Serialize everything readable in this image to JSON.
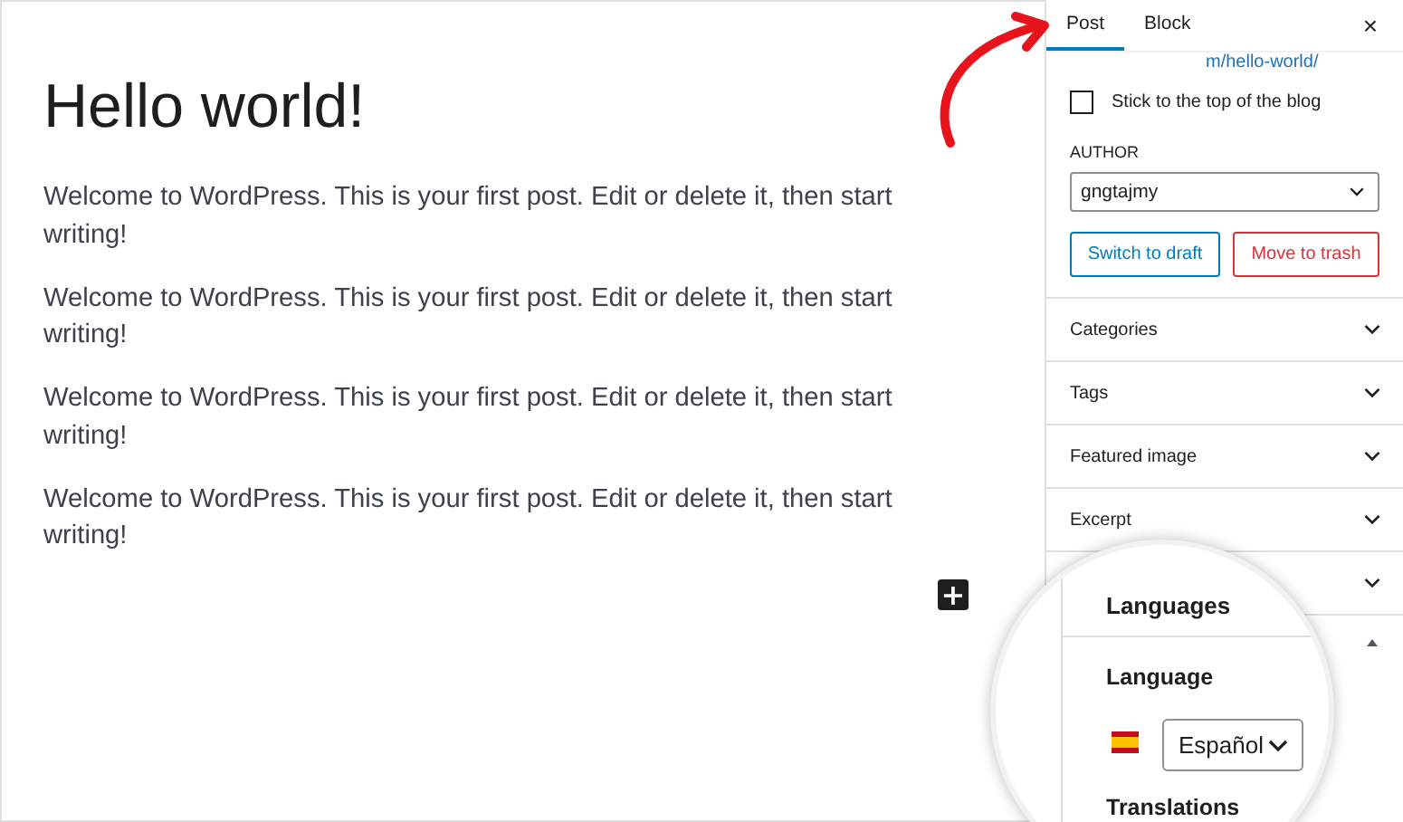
{
  "editor": {
    "title": "Hello world!",
    "paragraphs": [
      "Welcome to WordPress. This is your first post. Edit or delete it, then start writing!",
      "Welcome to WordPress. This is your first post. Edit or delete it, then start writing!",
      "Welcome to WordPress. This is your first post. Edit or delete it, then start writing!",
      "Welcome to WordPress. This is your first post. Edit or delete it, then start writing!"
    ],
    "inserter": "+"
  },
  "sidebar": {
    "tabs": [
      {
        "label": "Post",
        "selected": true
      },
      {
        "label": "Block",
        "selected": false
      }
    ],
    "close": "×",
    "permalink": "m/hello-world/",
    "sticky": {
      "label": "Stick to the top of the blog",
      "checked": false
    },
    "author": {
      "label": "AUTHOR",
      "value": "gngtajmy"
    },
    "buttons": [
      {
        "label": "Switch to draft",
        "kind": "secondary"
      },
      {
        "label": "Move to trash",
        "kind": "destructive"
      }
    ],
    "panels": [
      {
        "title": "Categories",
        "expanded": false
      },
      {
        "title": "Tags",
        "expanded": false
      },
      {
        "title": "Featured image",
        "expanded": false
      },
      {
        "title": "Excerpt",
        "expanded": false
      }
    ]
  },
  "magnifier": {
    "panel_title": "Languages",
    "field_label": "Language",
    "language": "Español",
    "section": "Translations"
  }
}
